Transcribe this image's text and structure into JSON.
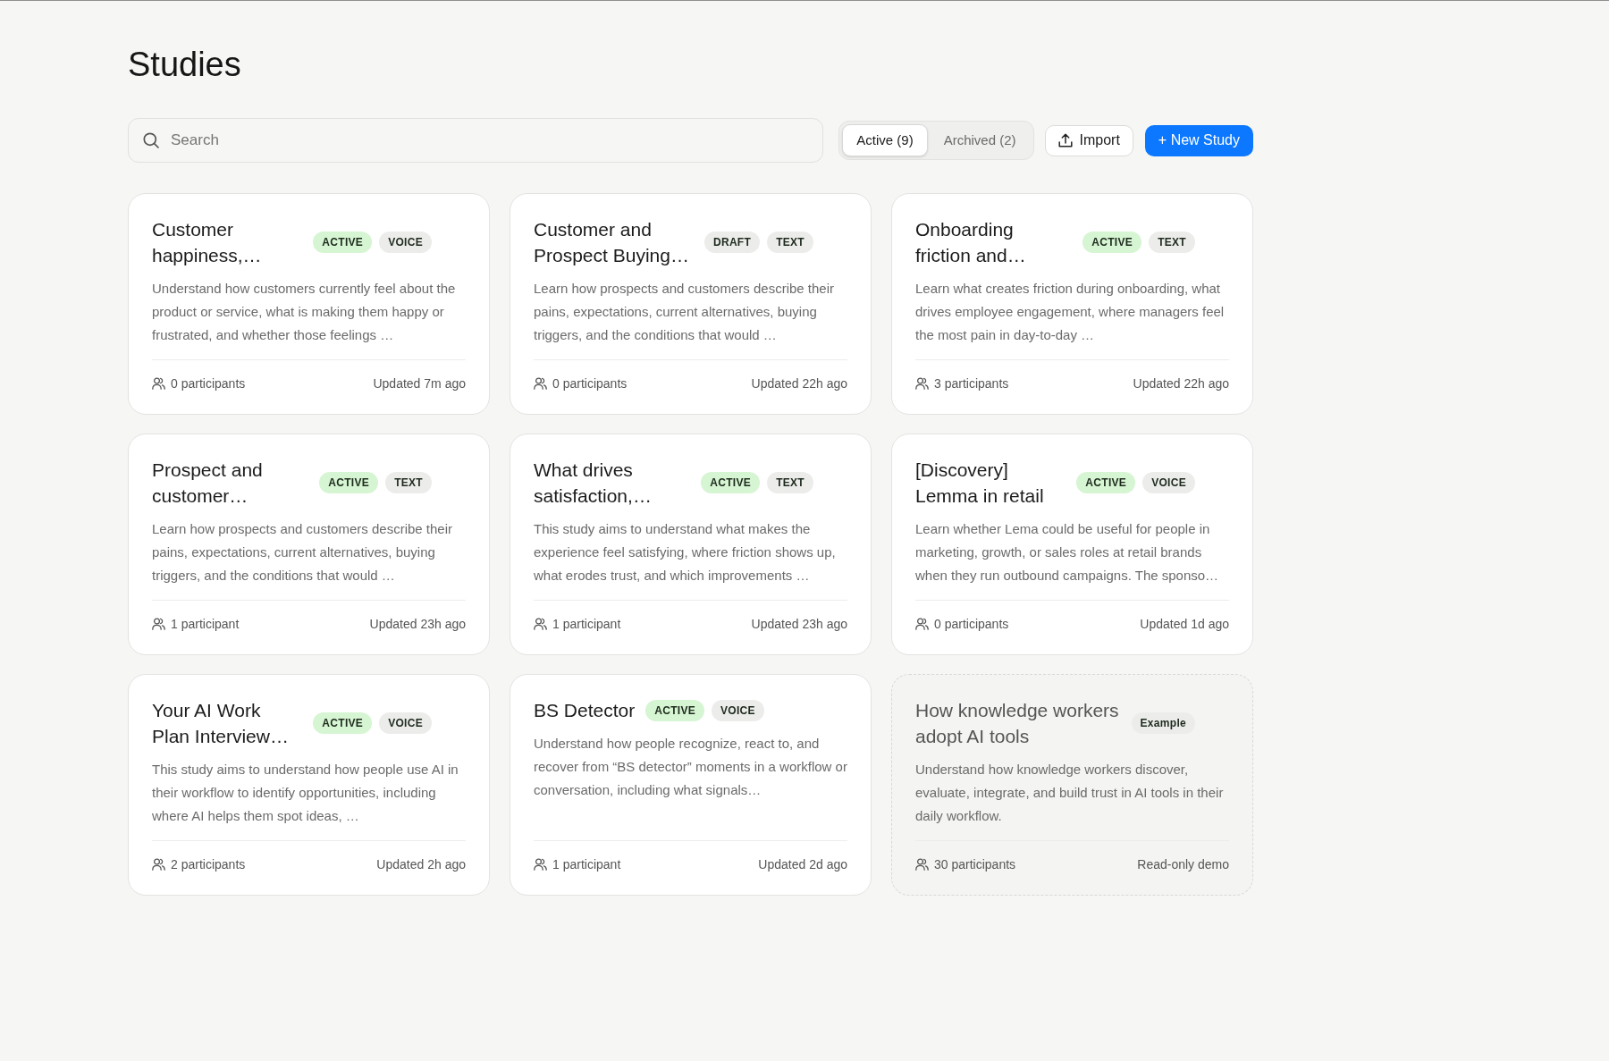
{
  "page": {
    "title": "Studies"
  },
  "toolbar": {
    "search": {
      "placeholder": "Search"
    },
    "filters": [
      {
        "label": "Active (9)",
        "selected": true
      },
      {
        "label": "Archived (2)",
        "selected": false
      }
    ],
    "buttons": [
      {
        "kind": "import",
        "label": "Import"
      },
      {
        "kind": "create",
        "label": "+ New Study"
      }
    ]
  },
  "studies": [
    {
      "kind": "study",
      "title": "Customer happiness,…",
      "tags": [
        {
          "label": "ACTIVE",
          "color": "#d6f5d2"
        },
        {
          "label": "VOICE",
          "color": "#ececea"
        }
      ],
      "description": "Understand how customers currently feel about the product or service, what is making them happy or frustrated, and whether those feelings …",
      "participants": "0 participants",
      "footer_note": "Updated 7m ago"
    },
    {
      "kind": "study",
      "title": "Customer and Prospect Buying…",
      "tags": [
        {
          "label": "DRAFT",
          "color": "#ececea"
        },
        {
          "label": "TEXT",
          "color": "#ececea"
        }
      ],
      "description": "Learn how prospects and customers describe their pains, expectations, current alternatives, buying triggers, and the conditions that would …",
      "participants": "0 participants",
      "footer_note": "Updated 22h ago"
    },
    {
      "kind": "study",
      "title": "Onboarding friction and…",
      "tags": [
        {
          "label": "ACTIVE",
          "color": "#d6f5d2"
        },
        {
          "label": "TEXT",
          "color": "#ececea"
        }
      ],
      "description": "Learn what creates friction during onboarding, what drives employee engagement, where managers feel the most pain in day-to-day …",
      "participants": "3 participants",
      "footer_note": "Updated 22h ago"
    },
    {
      "kind": "study",
      "title": "Prospect and customer…",
      "tags": [
        {
          "label": "ACTIVE",
          "color": "#d6f5d2"
        },
        {
          "label": "TEXT",
          "color": "#ececea"
        }
      ],
      "description": "Learn how prospects and customers describe their pains, expectations, current alternatives, buying triggers, and the conditions that would …",
      "participants": "1 participant",
      "footer_note": "Updated 23h ago"
    },
    {
      "kind": "study",
      "title": "What drives satisfaction,…",
      "tags": [
        {
          "label": "ACTIVE",
          "color": "#d6f5d2"
        },
        {
          "label": "TEXT",
          "color": "#ececea"
        }
      ],
      "description": "This study aims to understand what makes the experience feel satisfying, where friction shows up, what erodes trust, and which improvements …",
      "participants": "1 participant",
      "footer_note": "Updated 23h ago"
    },
    {
      "kind": "study",
      "title": "[Discovery] Lemma in retail",
      "tags": [
        {
          "label": "ACTIVE",
          "color": "#d6f5d2"
        },
        {
          "label": "VOICE",
          "color": "#ececea"
        }
      ],
      "description": "Learn whether Lema could be useful for people in marketing, growth, or sales roles at retail brands when they run outbound campaigns. The sponso…",
      "participants": "0 participants",
      "footer_note": "Updated 1d ago"
    },
    {
      "kind": "study",
      "title": "Your AI Work Plan Interview…",
      "tags": [
        {
          "label": "ACTIVE",
          "color": "#d6f5d2"
        },
        {
          "label": "VOICE",
          "color": "#ececea"
        }
      ],
      "description": "This study aims to understand how people use AI in their workflow to identify opportunities, including where AI helps them spot ideas, …",
      "participants": "2 participants",
      "footer_note": "Updated 2h ago"
    },
    {
      "kind": "study",
      "title": "BS Detector",
      "tags": [
        {
          "label": "ACTIVE",
          "color": "#d6f5d2"
        },
        {
          "label": "VOICE",
          "color": "#ececea"
        }
      ],
      "description": "Understand how people recognize, react to, and recover from “BS detector” moments in a workflow or conversation, including what signals…",
      "participants": "1 participant",
      "footer_note": "Updated 2d ago"
    },
    {
      "kind": "example",
      "title": "How knowledge workers adopt AI tools",
      "tags": [
        {
          "label": "Example",
          "color": "#ececea"
        }
      ],
      "description": "Understand how knowledge workers discover, evaluate, integrate, and build trust in AI tools in their daily workflow.",
      "participants": "30 participants",
      "footer_note": "Read-only demo"
    }
  ]
}
